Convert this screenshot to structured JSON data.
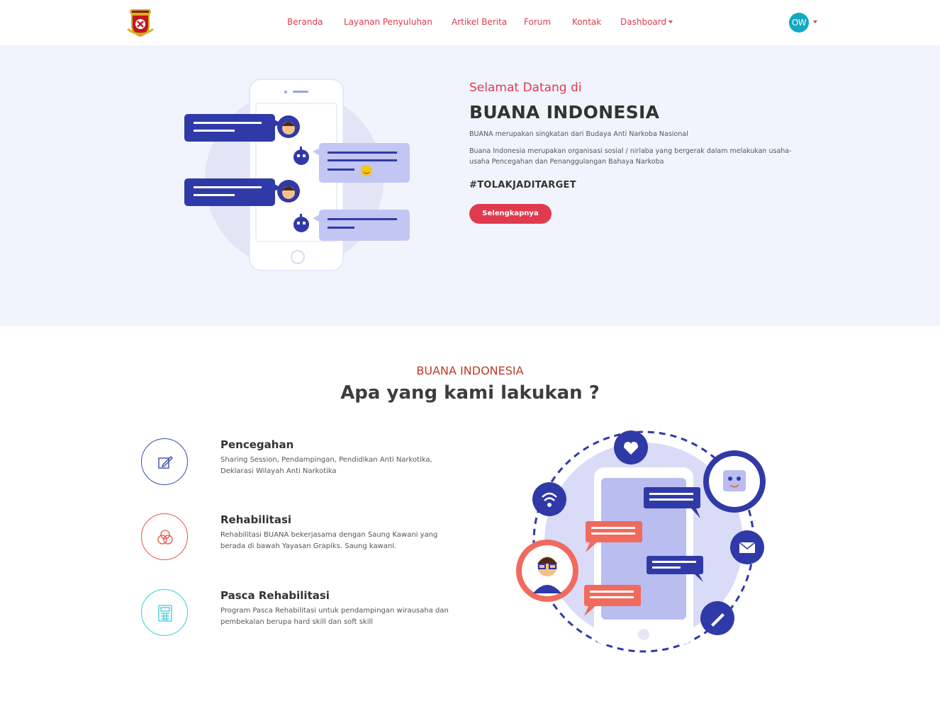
{
  "nav": {
    "items": [
      {
        "label": "Beranda"
      },
      {
        "label": "Layanan Penyuluhan"
      },
      {
        "label": "Artikel Berita"
      },
      {
        "label": "Forum"
      },
      {
        "label": "Kontak"
      },
      {
        "label": "Dashboard"
      }
    ],
    "avatar_initials": "OW"
  },
  "hero": {
    "greeting": "Selamat Datang di",
    "title": "BUANA INDONESIA",
    "subtitle": "BUANA merupakan singkatan dari Budaya Anti Narkoba Nasional",
    "description": "Buana Indonesia merupakan organisasi sosial / nirlaba yang bergerak dalam melakukan usaha-usaha Pencegahan dan Penanggulangan Bahaya Narkoba",
    "hashtag": "#TOLAKJADITARGET",
    "button_label": "Selengkapnya"
  },
  "services_section": {
    "kicker": "BUANA INDONESIA",
    "title": "Apa yang kami lakukan ?",
    "items": [
      {
        "title": "Pencegahan",
        "description": "Sharing Session, Pendampingan, Pendidikan Anti Narkotika, Deklarasi Wilayah Anti Narkotika",
        "icon": "edit-icon",
        "color": "#3b4bb0"
      },
      {
        "title": "Rehabilitasi",
        "description": "Rehabilitasi BUANA bekerjasama dengan Saung Kawani yang berada di bawah Yayasan Grapiks. Saung kawani.",
        "icon": "circles-icon",
        "color": "#e8534a"
      },
      {
        "title": "Pasca Rehabilitasi",
        "description": "Program Pasca Rehabilitasi untuk pendampingan wirausaha dan pembekalan berupa hard skill dan soft skill",
        "icon": "calculator-icon",
        "color": "#3ec8d8"
      }
    ]
  },
  "colors": {
    "accent": "#e03a4e",
    "hero_bg": "#f2f4fd",
    "indigo": "#2f3aa8",
    "avatar": "#12a8c0"
  }
}
